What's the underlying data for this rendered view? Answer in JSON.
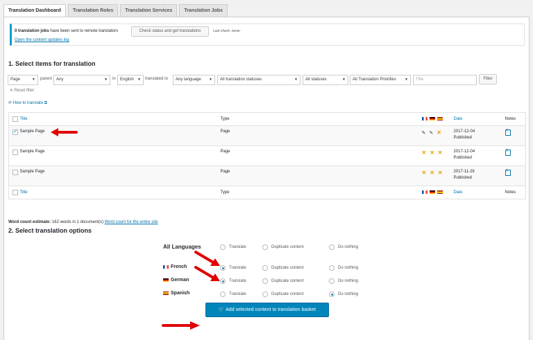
{
  "tabs": [
    "Translation Dashboard",
    "Translation Roles",
    "Translation Services",
    "Translation Jobs"
  ],
  "notice": {
    "count_bold": "0 translation jobs",
    "text": " have been sent to remote translators",
    "check_button": "Check status and get translations",
    "last_check": "Last check: never",
    "log_link": "Open the content updates log"
  },
  "section1": {
    "heading": "1. Select items for translation",
    "filters": {
      "type": "Page",
      "parent_label": "parent",
      "parent": "Any",
      "in_label": "in",
      "language": "English",
      "translated_to_label": "translated to",
      "target": "Any language",
      "statuses": "All translation statuses",
      "post_status": "All statuses",
      "priorities": "All Translation Priorities",
      "title_placeholder": "Title",
      "filter_button": "Filter",
      "reset": "Reset filter"
    },
    "how_to": "How to translate",
    "columns": {
      "title": "Title",
      "type": "Type",
      "date": "Date",
      "notes": "Notes"
    },
    "rows": [
      {
        "title": "Sample Page",
        "type": "Page",
        "date": "2017-12-04",
        "status": "Published"
      },
      {
        "title": "Sample Page",
        "type": "Page",
        "date": "2017-12-04",
        "status": "Published"
      },
      {
        "title": "Sample Page",
        "type": "Page",
        "date": "2017-11-29",
        "status": "Published"
      }
    ],
    "word_count_label": "Word count estimate:",
    "word_count_text": " 162 words in 1 document(s) ",
    "word_count_link": "Word count for the entire site"
  },
  "section2": {
    "heading": "2. Select translation options",
    "all_languages": "All Languages",
    "languages": [
      "French",
      "German",
      "Spanish"
    ],
    "options": {
      "translate": "Translate",
      "duplicate": "Duplicate content",
      "nothing": "Do nothing"
    },
    "basket_button": "Add selected content to translation basket"
  },
  "colors": {
    "accent": "#0073aa",
    "button": "#0085ba",
    "arrow": "#e00000",
    "x": "#e8a000"
  }
}
